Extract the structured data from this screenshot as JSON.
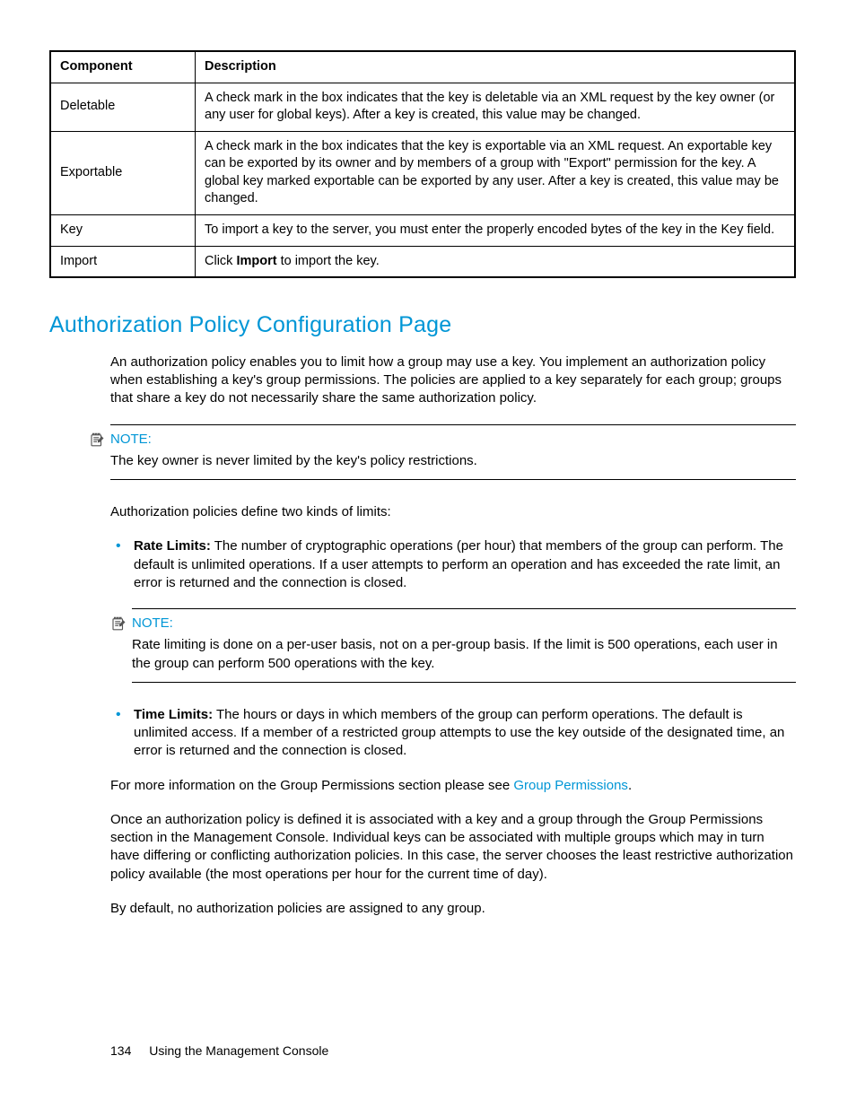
{
  "table": {
    "headers": [
      "Component",
      "Description"
    ],
    "rows": [
      {
        "component": "Deletable",
        "description": "A check mark in the box indicates that the key is deletable via an XML request by the key owner (or any user for global keys). After a key is created, this value may be changed."
      },
      {
        "component": "Exportable",
        "description": "A check mark in the box indicates that the key is exportable via an XML request. An exportable key can be exported by its owner and by members of a group with \"Export\" permission for the key. A global key marked exportable can be exported by any user. After a key is created, this value may be changed."
      },
      {
        "component": "Key",
        "description": "To import a key to the server, you must enter the properly encoded bytes of the key in the Key field."
      },
      {
        "component": "Import",
        "description_pre": "Click ",
        "description_bold": "Import",
        "description_post": " to import the key."
      }
    ]
  },
  "section_title": "Authorization Policy Configuration Page",
  "intro": "An authorization policy enables you to limit how a group may use a key. You implement an authorization policy when establishing a key's group permissions. The policies are applied to a key separately for each group; groups that share a key do not necessarily share the same authorization policy.",
  "note_label": "NOTE:",
  "note1_body": "The key owner is never limited by the key's policy restrictions.",
  "limits_intro": "Authorization policies define two kinds of limits:",
  "rate_label": "Rate Limits:",
  "rate_body": " The number of cryptographic operations (per hour) that members of the group can perform. The default is unlimited operations. If a user attempts to perform an operation and has exceeded the rate limit, an error is returned and the connection is closed.",
  "note2_body": "Rate limiting is done on a per-user basis, not on a per-group basis. If the limit is 500 operations, each user in the group can perform 500 operations with the key.",
  "time_label": "Time Limits:",
  "time_body": " The hours or days in which members of the group can perform operations. The default is unlimited access. If a member of a restricted group attempts to use the key outside of the designated time, an error is returned and the connection is closed.",
  "more_info_pre": "For more information on the Group Permissions section please see ",
  "more_info_link": "Group Permissions",
  "more_info_post": ".",
  "assoc": "Once an authorization policy is defined it is associated with a key and a group through the Group Permissions section in the Management Console. Individual keys can be associated with multiple groups which may in turn have differing or conflicting authorization policies. In this case, the server chooses the least restrictive authorization policy available (the most operations per hour for the current time of day).",
  "default_p": "By default, no authorization policies are assigned to any group.",
  "footer": {
    "page": "134",
    "title": "Using the Management Console"
  }
}
